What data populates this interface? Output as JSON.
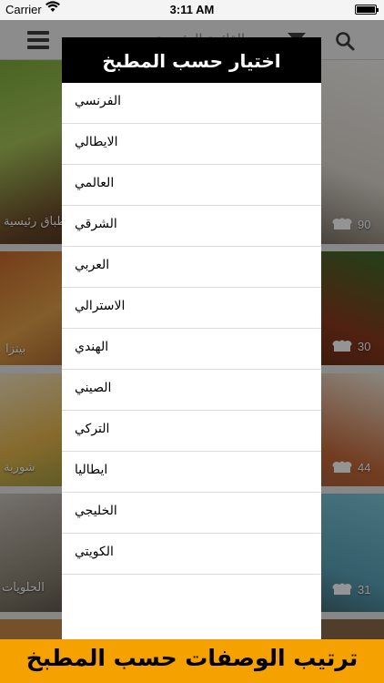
{
  "status_bar": {
    "carrier": "Carrier",
    "time": "3:11 AM"
  },
  "navbar": {
    "title": "القائمة الرئيسية",
    "icons": [
      "menu-icon",
      "filter-icon",
      "search-icon"
    ]
  },
  "tiles": [
    {
      "label": "اطباق رئيسية",
      "count": "90"
    },
    {
      "label": "بيتزا",
      "count": "30"
    },
    {
      "label": "شوربة",
      "count": "44"
    },
    {
      "label": "الحلويات",
      "count": "31"
    }
  ],
  "modal": {
    "title": "اختيار حسب المطبخ",
    "options": [
      "الفرنسي",
      "الايطالي",
      "العالمي",
      "الشرقي",
      "العربي",
      "الاسترالي",
      "الهندي",
      "الصيني",
      "التركي",
      "ايطاليا",
      "الخليجي",
      "الكويتي"
    ]
  },
  "banner": {
    "text": "ترتيب الوصفات حسب المطبخ"
  },
  "colors": {
    "accent": "#f5a100",
    "header_bg": "#000000",
    "navbar_bg": "#f2f2f2"
  }
}
